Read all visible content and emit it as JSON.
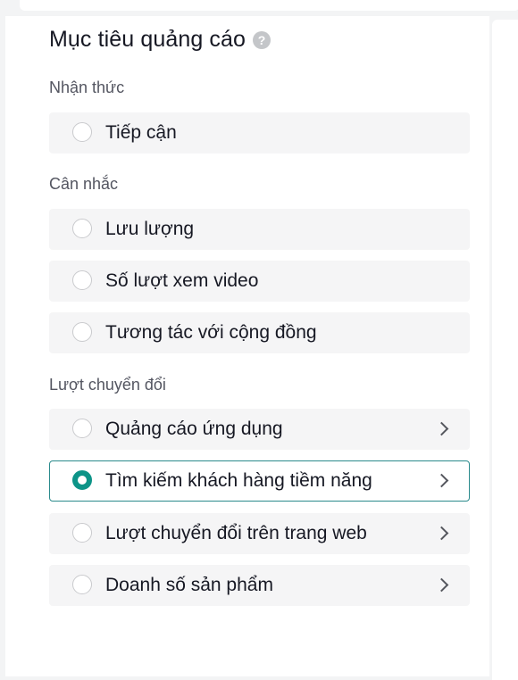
{
  "objective": {
    "title": "Mục tiêu quảng cáo",
    "help_icon": "question-circle-icon",
    "help_glyph": "?",
    "accent_color": "#0d9488",
    "sections": [
      {
        "label": "Nhận thức",
        "options": [
          {
            "label": "Tiếp cận",
            "selected": false,
            "has_chevron": false
          }
        ]
      },
      {
        "label": "Cân nhắc",
        "options": [
          {
            "label": "Lưu lượng",
            "selected": false,
            "has_chevron": false
          },
          {
            "label": "Số lượt xem video",
            "selected": false,
            "has_chevron": false
          },
          {
            "label": "Tương tác với cộng đồng",
            "selected": false,
            "has_chevron": false
          }
        ]
      },
      {
        "label": "Lượt chuyển đổi",
        "options": [
          {
            "label": "Quảng cáo ứng dụng",
            "selected": false,
            "has_chevron": true
          },
          {
            "label": "Tìm kiếm khách hàng tiềm năng",
            "selected": true,
            "has_chevron": true
          },
          {
            "label": "Lượt chuyển đổi trên trang web",
            "selected": false,
            "has_chevron": true
          },
          {
            "label": "Doanh số sản phẩm",
            "selected": false,
            "has_chevron": true
          }
        ]
      }
    ]
  }
}
